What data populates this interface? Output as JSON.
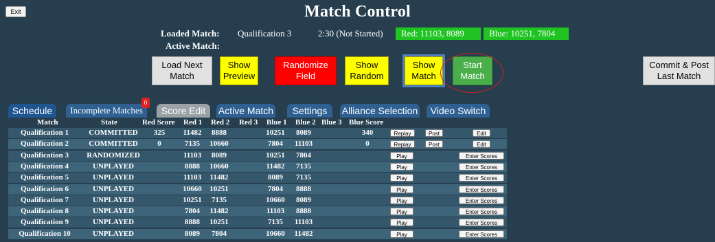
{
  "header": {
    "exit_label": "Exit",
    "title": "Match Control",
    "loaded_match_label": "Loaded Match:",
    "loaded_match_value": "Qualification 3",
    "active_match_label": "Active Match:",
    "timer_status": "2:30 (Not Started)",
    "red_alliance": "Red: 11103, 8089",
    "blue_alliance": "Blue: 10251, 7804"
  },
  "controls": {
    "load_next_match": "Load Next\nMatch",
    "show_preview": "Show\nPreview",
    "randomize_field": "Randomize\nField",
    "show_random": "Show\nRandom",
    "show_match": "Show\nMatch",
    "start_match": "Start\nMatch",
    "commit_post": "Commit & Post\nLast Match"
  },
  "tabs": {
    "schedule": "Schedule",
    "incomplete": "Incomplete Matches",
    "incomplete_count": "0",
    "score_edit": "Score Edit",
    "active_match": "Active Match",
    "settings": "Settings",
    "alliance_selection": "Alliance Selection",
    "video_switch": "Video Switch"
  },
  "table": {
    "columns": [
      "Match",
      "State",
      "Red Score",
      "Red 1",
      "Red 2",
      "Red 3",
      "Blue 1",
      "Blue 2",
      "Blue 3",
      "Blue Score"
    ],
    "rows": [
      {
        "match": "Qualification 1",
        "state": "COMMITTED",
        "red_score": "325",
        "red1": "11482",
        "red2": "8888",
        "red3": "",
        "blue1": "10251",
        "blue2": "8089",
        "blue3": "",
        "blue_score": "340",
        "buttons": [
          "Replay",
          "Post",
          "Edit"
        ]
      },
      {
        "match": "Qualification 2",
        "state": "COMMITTED",
        "red_score": "0",
        "red1": "7135",
        "red2": "10660",
        "red3": "",
        "blue1": "7804",
        "blue2": "11103",
        "blue3": "",
        "blue_score": "0",
        "buttons": [
          "Replay",
          "Post",
          "Edit"
        ]
      },
      {
        "match": "Qualification 3",
        "state": "RANDOMIZED",
        "red_score": "",
        "red1": "11103",
        "red2": "8089",
        "red3": "",
        "blue1": "10251",
        "blue2": "7804",
        "blue3": "",
        "blue_score": "",
        "buttons": [
          "Play",
          "",
          "Enter Scores"
        ]
      },
      {
        "match": "Qualification 4",
        "state": "UNPLAYED",
        "red_score": "",
        "red1": "8888",
        "red2": "10660",
        "red3": "",
        "blue1": "11482",
        "blue2": "7135",
        "blue3": "",
        "blue_score": "",
        "buttons": [
          "Play",
          "",
          "Enter Scores"
        ]
      },
      {
        "match": "Qualification 5",
        "state": "UNPLAYED",
        "red_score": "",
        "red1": "11103",
        "red2": "11482",
        "red3": "",
        "blue1": "8089",
        "blue2": "7135",
        "blue3": "",
        "blue_score": "",
        "buttons": [
          "Play",
          "",
          "Enter Scores"
        ]
      },
      {
        "match": "Qualification 6",
        "state": "UNPLAYED",
        "red_score": "",
        "red1": "10660",
        "red2": "10251",
        "red3": "",
        "blue1": "7804",
        "blue2": "8888",
        "blue3": "",
        "blue_score": "",
        "buttons": [
          "Play",
          "",
          "Enter Scores"
        ]
      },
      {
        "match": "Qualification 7",
        "state": "UNPLAYED",
        "red_score": "",
        "red1": "10251",
        "red2": "7135",
        "red3": "",
        "blue1": "10660",
        "blue2": "8089",
        "blue3": "",
        "blue_score": "",
        "buttons": [
          "Play",
          "",
          "Enter Scores"
        ]
      },
      {
        "match": "Qualification 8",
        "state": "UNPLAYED",
        "red_score": "",
        "red1": "7804",
        "red2": "11482",
        "red3": "",
        "blue1": "11103",
        "blue2": "8888",
        "blue3": "",
        "blue_score": "",
        "buttons": [
          "Play",
          "",
          "Enter Scores"
        ]
      },
      {
        "match": "Qualification 9",
        "state": "UNPLAYED",
        "red_score": "",
        "red1": "8888",
        "red2": "10251",
        "red3": "",
        "blue1": "7135",
        "blue2": "11103",
        "blue3": "",
        "blue_score": "",
        "buttons": [
          "Play",
          "",
          "Enter Scores"
        ]
      },
      {
        "match": "Qualification 10",
        "state": "UNPLAYED",
        "red_score": "",
        "red1": "8089",
        "red2": "7804",
        "red3": "",
        "blue1": "10660",
        "blue2": "11482",
        "blue3": "",
        "blue_score": "",
        "buttons": [
          "Play",
          "",
          "Enter Scores"
        ]
      }
    ]
  },
  "colors": {
    "background": "#263e4e",
    "alliance_badge": "#1fc423",
    "randomize": "#ff0000",
    "start": "#4aaf4a",
    "show": "#ffff00"
  }
}
